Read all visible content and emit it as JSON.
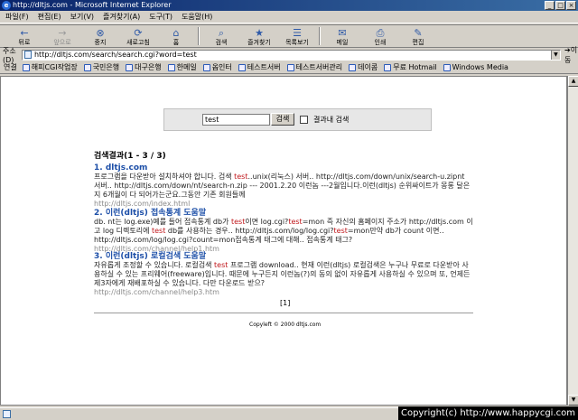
{
  "window": {
    "title": "http://dltjs.com - Microsoft Internet Explorer",
    "min": "_",
    "max": "□",
    "close": "×"
  },
  "menu": [
    "파일(F)",
    "편집(E)",
    "보기(V)",
    "즐겨찾기(A)",
    "도구(T)",
    "도움말(H)"
  ],
  "toolbar": [
    {
      "label": "뒤로",
      "glyph": "←",
      "enabled": true
    },
    {
      "label": "앞으로",
      "glyph": "→",
      "enabled": false
    },
    {
      "label": "중지",
      "glyph": "⊗",
      "enabled": true
    },
    {
      "label": "새로고침",
      "glyph": "⟳",
      "enabled": true
    },
    {
      "label": "홈",
      "glyph": "⌂",
      "enabled": true
    },
    {
      "label": "검색",
      "glyph": "⌕",
      "enabled": true
    },
    {
      "label": "즐겨찾기",
      "glyph": "★",
      "enabled": true
    },
    {
      "label": "목록보기",
      "glyph": "☰",
      "enabled": true
    },
    {
      "label": "메일",
      "glyph": "✉",
      "enabled": true
    },
    {
      "label": "인쇄",
      "glyph": "⎙",
      "enabled": true
    },
    {
      "label": "편집",
      "glyph": "✎",
      "enabled": true
    }
  ],
  "address": {
    "label": "주소(D)",
    "url": "http://dltjs.com/search/search.cgi?word=test",
    "go": "이동"
  },
  "links": {
    "label": "연결",
    "items": [
      "해피CGI작업장",
      "국민은행",
      "대구은행",
      "한메일",
      "옵인터",
      "테스트서버",
      "테스트서버관리",
      "데이콤",
      "무료 Hotmail",
      "Windows Media"
    ]
  },
  "search": {
    "value": "test",
    "button": "검색",
    "checkbox_label": "결과내 검색"
  },
  "results_title": "검색결과(1 - 3 / 3)",
  "results": [
    {
      "num": "1.",
      "title": "dltjs.com",
      "desc_parts": [
        {
          "t": "프로그램을 다운받아 설치하셔야 합니다. 검색 "
        },
        {
          "t": "test",
          "hl": true
        },
        {
          "t": "..unix(리눅스) 서버..   http://dltjs.com/down/unix/search-u.zipnt 서버..   http://dltjs.com/down/nt/search-n.zip --- 2001.2.20 이런놈 ---2월입니다.이런(dltjs) 순위싸이트가 몽롱 달은 지 6개월이 다 되어가는군요.그동안 기존 회원들께"
        }
      ],
      "url": "http://dltjs.com/index.html"
    },
    {
      "num": "2.",
      "title": "이런(dltjs) 접속통계 도움말",
      "desc_parts": [
        {
          "t": "db. nt는 log.exe)예를 들어 접속통계 db가 "
        },
        {
          "t": "test",
          "hl": true
        },
        {
          "t": "이면 log.cgi?"
        },
        {
          "t": "test",
          "hl": true
        },
        {
          "t": "=mon 즉 자신의 홈페이지 주소가 http://dltjs.com 이고 log 디렉토리에 "
        },
        {
          "t": "test",
          "hl": true
        },
        {
          "t": " db를 사용하는 경우.. http://dltjs.com/log/log.cgi?"
        },
        {
          "t": "test",
          "hl": true
        },
        {
          "t": "=mon만약 db가 count 이면.. http://dltjs.com/log/log.cgi?count=mon접속통계 태그에 대해.. 접속통계 태그?"
        }
      ],
      "url": "http://dltjs.com/channel/help1.htm"
    },
    {
      "num": "3.",
      "title": "이런(dltjs) 로컬검색 도움말",
      "desc_parts": [
        {
          "t": "자유롭게 조정할 수 있습니다. 로컬검색 "
        },
        {
          "t": "test",
          "hl": true
        },
        {
          "t": " 프로그램 download.. 현재 이런(dltjs) 로컬검색은 누구나 무료로 다운받아 사용하실 수 있는 프리웨어(freeware)입니다. 때문에 누구든지 이런놈(?)의 동의 없이 자유롭게 사용하실 수 있으며 또, 언제든 제3자에게 재배포하실 수 있습니다. 다만 다운로드 받으?"
        }
      ],
      "url": "http://dltjs.com/channel/help3.htm"
    }
  ],
  "pager": "[1]",
  "copyright": "Copyleft © 2000 dltjs.com",
  "watermark": "Copyright(c) http://www.happycgi.com"
}
